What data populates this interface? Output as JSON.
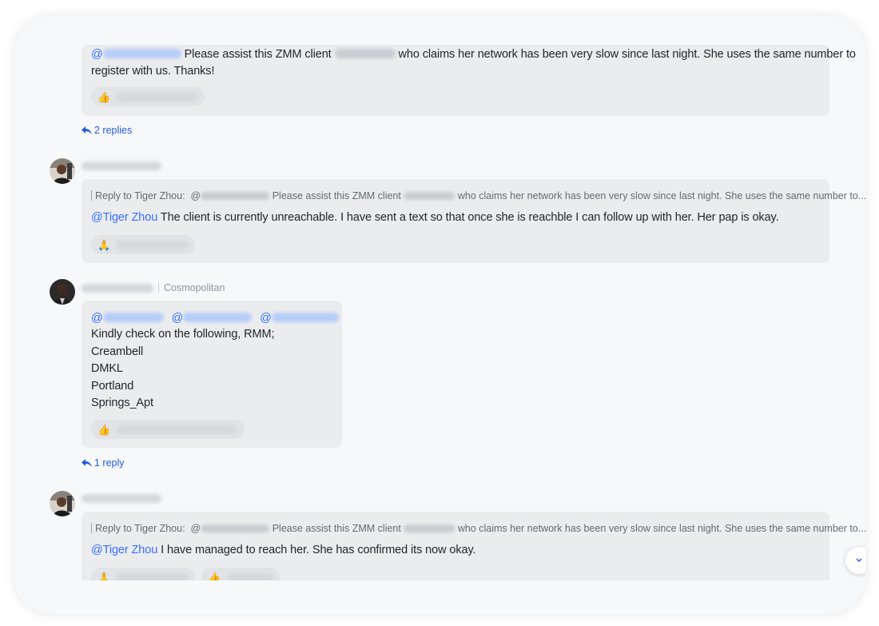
{
  "messages": {
    "m1": {
      "text_before": "Please assist this ZMM client",
      "text_after": "who claims her network has been very slow since last night. She uses the same number to",
      "text_line2": "register with us. Thanks!",
      "mention_prefix": "@",
      "reaction_emoji": "👍",
      "replies_label": "2 replies"
    },
    "m2": {
      "quote_prefix": "Reply to Tiger Zhou:",
      "quote_at": "@",
      "quote_mid": "Please assist this ZMM client",
      "quote_end": "who claims her network has been very slow since last night. She uses the same number to...",
      "mention": "@Tiger Zhou",
      "text": "The client is currently unreachable. I have sent a text so that once she is reachble I can follow up with her. Her pap is okay.",
      "reaction_emoji": "🙏"
    },
    "m3": {
      "department": "Cosmopolitan",
      "mention_prefix": "@",
      "lines": [
        "Kindly check on the following, RMM;",
        "Creambell",
        "DMKL",
        "Portland",
        "Springs_Apt"
      ],
      "reaction_emoji": "👍",
      "replies_label": "1 reply"
    },
    "m4": {
      "quote_prefix": "Reply to Tiger Zhou:",
      "quote_at": "@",
      "quote_mid": "Please assist this ZMM client",
      "quote_end": "who claims her network has been very slow since last night. She uses the same number to...",
      "mention": "@Tiger Zhou",
      "text": "I have managed to reach her. She has confirmed its now okay.",
      "reaction_emoji_1": "🙏",
      "reaction_emoji_2": "👍"
    }
  },
  "colors": {
    "mention": "#3370ff",
    "bubble": "#ebecee",
    "link": "#245bdb"
  },
  "icons": {
    "reply": "reply-arrow-icon",
    "scroll": "chevron-down-icon"
  }
}
